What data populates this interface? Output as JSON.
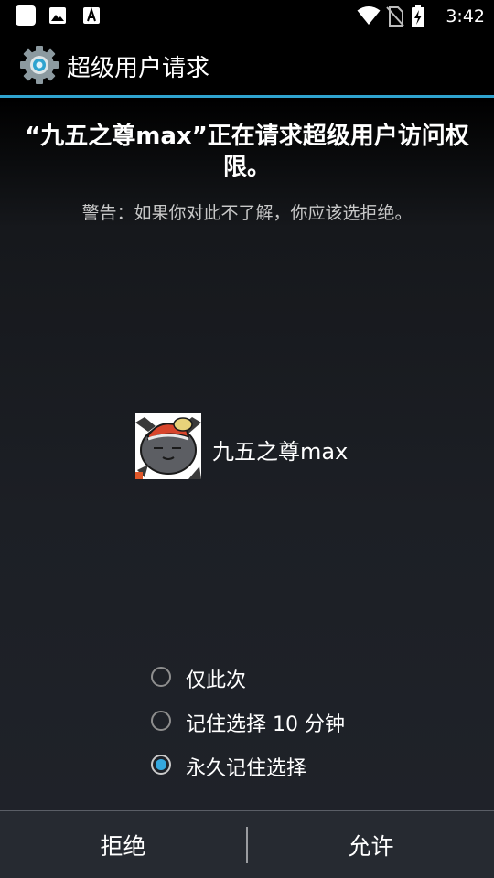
{
  "status_bar": {
    "time": "3:42",
    "icons": [
      "notification-square-icon",
      "image-icon",
      "font-a-icon",
      "wifi-icon",
      "no-sim-icon",
      "battery-charging-icon"
    ]
  },
  "title_bar": {
    "title": "超级用户请求",
    "icon": "gear-icon",
    "accent_color": "#2fa3cf"
  },
  "request": {
    "headline": "“九五之尊max”正在请求超级用户访问权限。",
    "warning": "警告：如果你对此不了解，你应该选拒绝。"
  },
  "app": {
    "name": "九五之尊max",
    "icon": "cat-avatar-icon"
  },
  "options": {
    "items": [
      {
        "label": "仅此次",
        "checked": false
      },
      {
        "label": "记住选择 10 分钟",
        "checked": false
      },
      {
        "label": "永久记住选择",
        "checked": true
      }
    ],
    "checked_color": "#35a8de"
  },
  "footer": {
    "deny_label": "拒绝",
    "allow_label": "允许"
  }
}
